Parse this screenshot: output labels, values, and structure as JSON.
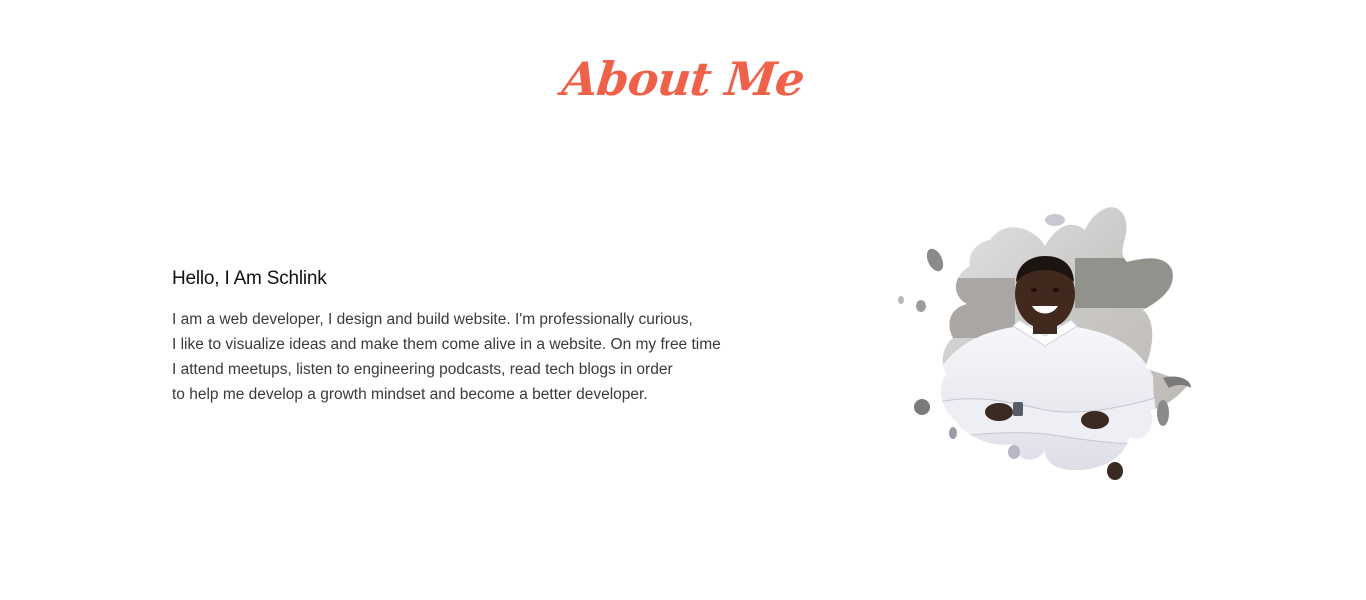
{
  "about": {
    "title": "About Me",
    "greeting": "Hello, I Am Schlink",
    "bio_lines": [
      "I am a web developer, I design and build website. I'm professionally curious,",
      "I like to visualize ideas and make them come alive in a website. On my free time",
      "I attend meetups, listen to engineering podcasts, read tech blogs in order",
      "to help me develop a growth mindset and become a better developer."
    ]
  },
  "colors": {
    "accent": "#f0614a",
    "text_primary": "#111111",
    "text_body": "#3a3a3a",
    "background": "#ffffff"
  },
  "portrait": {
    "icon": "profile-photo-splash"
  }
}
